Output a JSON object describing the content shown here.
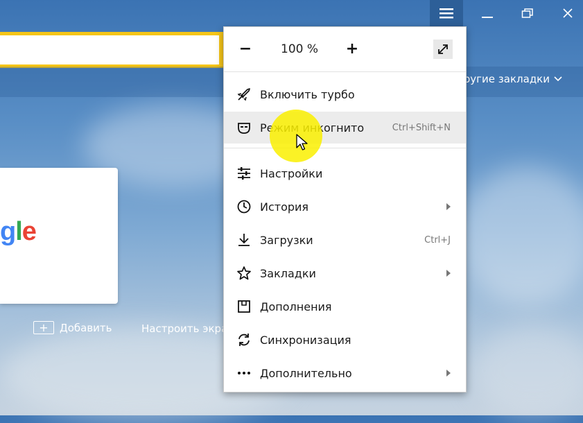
{
  "window": {
    "minimize_icon": "minimize-icon",
    "restore_icon": "restore-icon",
    "close_icon": "close-icon",
    "menu_icon": "hamburger-icon"
  },
  "bookmarks": {
    "other_label": "ругие закладки"
  },
  "tiles": {
    "google_letters": [
      "g",
      "l",
      "e"
    ]
  },
  "newtab": {
    "add_label": "Добавить",
    "setup_label": "Настроить экра"
  },
  "menu": {
    "zoom": {
      "minus": "−",
      "value": "100 %",
      "plus": "+"
    },
    "items": [
      {
        "label": "Включить турбо",
        "icon": "rocket-icon",
        "shortcut": ""
      },
      {
        "label": "Режим инкогнито",
        "icon": "incognito-mask-icon",
        "shortcut": "Ctrl+Shift+N"
      },
      {
        "label": "Настройки",
        "icon": "sliders-icon",
        "shortcut": ""
      },
      {
        "label": "История",
        "icon": "clock-icon",
        "shortcut": ""
      },
      {
        "label": "Загрузки",
        "icon": "download-icon",
        "shortcut": "Ctrl+J"
      },
      {
        "label": "Закладки",
        "icon": "star-icon",
        "shortcut": ""
      },
      {
        "label": "Дополнения",
        "icon": "extensions-icon",
        "shortcut": ""
      },
      {
        "label": "Синхронизация",
        "icon": "sync-icon",
        "shortcut": ""
      },
      {
        "label": "Дополнительно",
        "icon": "more-dots-icon",
        "shortcut": ""
      }
    ]
  },
  "colors": {
    "accent": "#f5c518",
    "highlight": "#faf000",
    "menu_btn": "#2d5f98"
  }
}
